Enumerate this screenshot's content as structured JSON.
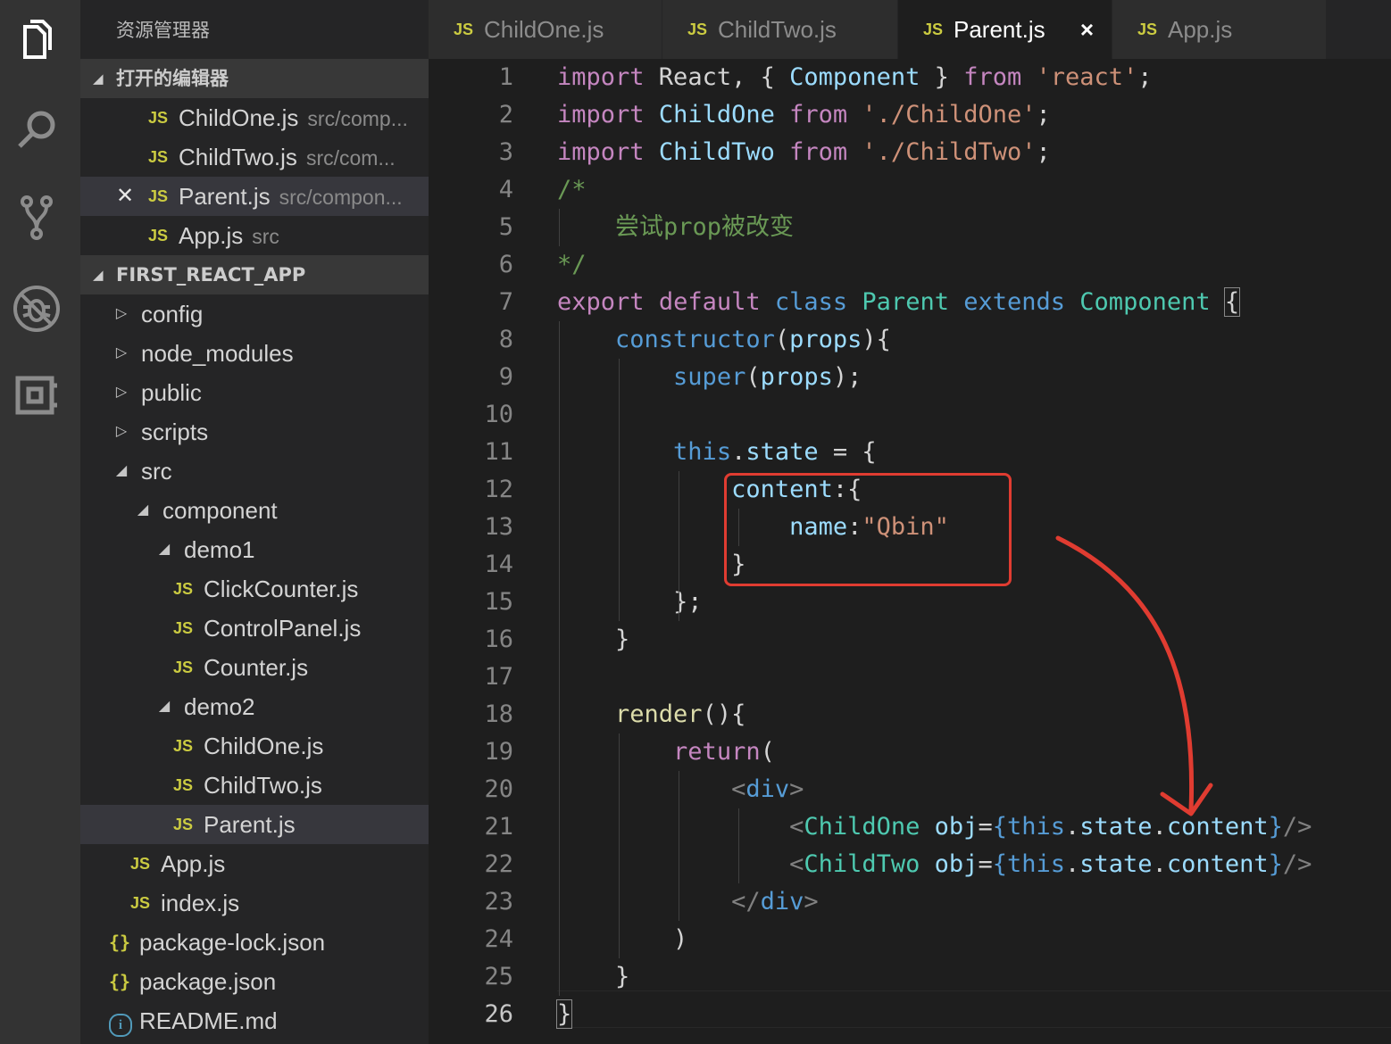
{
  "sidebar": {
    "title": "资源管理器",
    "open_editors": {
      "header": "打开的编辑器",
      "items": [
        {
          "name": "ChildOne.js",
          "path": "src/comp..."
        },
        {
          "name": "ChildTwo.js",
          "path": "src/com..."
        },
        {
          "name": "Parent.js",
          "path": "src/compon..."
        },
        {
          "name": "App.js",
          "path": "src"
        }
      ]
    },
    "project": {
      "header": "FIRST_REACT_APP",
      "tree": [
        {
          "label": "config",
          "kind": "folder-collapsed"
        },
        {
          "label": "node_modules",
          "kind": "folder-collapsed"
        },
        {
          "label": "public",
          "kind": "folder-collapsed"
        },
        {
          "label": "scripts",
          "kind": "folder-collapsed"
        },
        {
          "label": "src",
          "kind": "folder-expanded"
        },
        {
          "label": "component",
          "kind": "folder-expanded"
        },
        {
          "label": "demo1",
          "kind": "folder-expanded"
        },
        {
          "label": "ClickCounter.js",
          "kind": "js"
        },
        {
          "label": "ControlPanel.js",
          "kind": "js"
        },
        {
          "label": "Counter.js",
          "kind": "js"
        },
        {
          "label": "demo2",
          "kind": "folder-expanded"
        },
        {
          "label": "ChildOne.js",
          "kind": "js"
        },
        {
          "label": "ChildTwo.js",
          "kind": "js"
        },
        {
          "label": "Parent.js",
          "kind": "js"
        },
        {
          "label": "App.js",
          "kind": "js"
        },
        {
          "label": "index.js",
          "kind": "js"
        },
        {
          "label": "package-lock.json",
          "kind": "json"
        },
        {
          "label": "package.json",
          "kind": "json"
        },
        {
          "label": "README.md",
          "kind": "info"
        }
      ]
    }
  },
  "icons": {
    "js": "JS",
    "json": "{}",
    "info": "i",
    "close": "×",
    "close_dirty": "✕",
    "tri_down": "◢",
    "tri_right": "▷"
  },
  "tabs": [
    {
      "label": "ChildOne.js",
      "active": false
    },
    {
      "label": "ChildTwo.js",
      "active": false
    },
    {
      "label": "Parent.js",
      "active": true
    },
    {
      "label": "App.js",
      "active": false
    }
  ],
  "editor": {
    "current_line": 26,
    "line_numbers": [
      "1",
      "2",
      "3",
      "4",
      "5",
      "6",
      "7",
      "8",
      "9",
      "10",
      "11",
      "12",
      "13",
      "14",
      "15",
      "16",
      "17",
      "18",
      "19",
      "20",
      "21",
      "22",
      "23",
      "24",
      "25",
      "26"
    ],
    "lines": [
      [
        {
          "t": "import",
          "c": "kw"
        },
        {
          "t": " React, { ",
          "c": ""
        },
        {
          "t": "Component",
          "c": "vr"
        },
        {
          "t": " } ",
          "c": ""
        },
        {
          "t": "from",
          "c": "kw"
        },
        {
          "t": " ",
          "c": ""
        },
        {
          "t": "'react'",
          "c": "st"
        },
        {
          "t": ";",
          "c": ""
        }
      ],
      [
        {
          "t": "import",
          "c": "kw"
        },
        {
          "t": " ",
          "c": ""
        },
        {
          "t": "ChildOne",
          "c": "vr"
        },
        {
          "t": " ",
          "c": ""
        },
        {
          "t": "from",
          "c": "kw"
        },
        {
          "t": " ",
          "c": ""
        },
        {
          "t": "'./ChildOne'",
          "c": "st"
        },
        {
          "t": ";",
          "c": ""
        }
      ],
      [
        {
          "t": "import",
          "c": "kw"
        },
        {
          "t": " ",
          "c": ""
        },
        {
          "t": "ChildTwo",
          "c": "vr"
        },
        {
          "t": " ",
          "c": ""
        },
        {
          "t": "from",
          "c": "kw"
        },
        {
          "t": " ",
          "c": ""
        },
        {
          "t": "'./ChildTwo'",
          "c": "st"
        },
        {
          "t": ";",
          "c": ""
        }
      ],
      [
        {
          "t": "/*",
          "c": "cm"
        }
      ],
      [
        {
          "t": "    尝试prop被改变",
          "c": "cm"
        }
      ],
      [
        {
          "t": "*/",
          "c": "cm"
        }
      ],
      [
        {
          "t": "export",
          "c": "kw"
        },
        {
          "t": " ",
          "c": ""
        },
        {
          "t": "default",
          "c": "kw"
        },
        {
          "t": " ",
          "c": ""
        },
        {
          "t": "class",
          "c": "bl"
        },
        {
          "t": " ",
          "c": ""
        },
        {
          "t": "Parent",
          "c": "cls"
        },
        {
          "t": " ",
          "c": ""
        },
        {
          "t": "extends",
          "c": "bl"
        },
        {
          "t": " ",
          "c": ""
        },
        {
          "t": "Component",
          "c": "cls"
        },
        {
          "t": " ",
          "c": ""
        },
        {
          "t": "{",
          "c": "box"
        }
      ],
      [
        {
          "t": "    ",
          "c": ""
        },
        {
          "t": "constructor",
          "c": "bl"
        },
        {
          "t": "(",
          "c": ""
        },
        {
          "t": "props",
          "c": "vr"
        },
        {
          "t": "){",
          "c": ""
        }
      ],
      [
        {
          "t": "        ",
          "c": ""
        },
        {
          "t": "super",
          "c": "bl"
        },
        {
          "t": "(",
          "c": ""
        },
        {
          "t": "props",
          "c": "vr"
        },
        {
          "t": ");",
          "c": ""
        }
      ],
      [
        {
          "t": "",
          "c": ""
        }
      ],
      [
        {
          "t": "        ",
          "c": ""
        },
        {
          "t": "this",
          "c": "bl"
        },
        {
          "t": ".",
          "c": ""
        },
        {
          "t": "state",
          "c": "vr"
        },
        {
          "t": " = {",
          "c": ""
        }
      ],
      [
        {
          "t": "            ",
          "c": ""
        },
        {
          "t": "content",
          "c": "vr"
        },
        {
          "t": ":{",
          "c": ""
        }
      ],
      [
        {
          "t": "                ",
          "c": ""
        },
        {
          "t": "name",
          "c": "vr"
        },
        {
          "t": ":",
          "c": ""
        },
        {
          "t": "\"Qbin\"",
          "c": "st"
        }
      ],
      [
        {
          "t": "            }",
          "c": ""
        }
      ],
      [
        {
          "t": "        };",
          "c": ""
        }
      ],
      [
        {
          "t": "    }",
          "c": ""
        }
      ],
      [
        {
          "t": "",
          "c": ""
        }
      ],
      [
        {
          "t": "    ",
          "c": ""
        },
        {
          "t": "render",
          "c": "fn"
        },
        {
          "t": "(){",
          "c": ""
        }
      ],
      [
        {
          "t": "        ",
          "c": ""
        },
        {
          "t": "return",
          "c": "kw"
        },
        {
          "t": "(",
          "c": ""
        }
      ],
      [
        {
          "t": "            ",
          "c": ""
        },
        {
          "t": "<",
          "c": "tg"
        },
        {
          "t": "div",
          "c": "bl"
        },
        {
          "t": ">",
          "c": "tg"
        }
      ],
      [
        {
          "t": "                ",
          "c": ""
        },
        {
          "t": "<",
          "c": "tg"
        },
        {
          "t": "ChildOne",
          "c": "cls"
        },
        {
          "t": " ",
          "c": ""
        },
        {
          "t": "obj",
          "c": "vr"
        },
        {
          "t": "=",
          "c": ""
        },
        {
          "t": "{",
          "c": "bl"
        },
        {
          "t": "this",
          "c": "bl"
        },
        {
          "t": ".",
          "c": ""
        },
        {
          "t": "state",
          "c": "vr"
        },
        {
          "t": ".",
          "c": ""
        },
        {
          "t": "content",
          "c": "vr"
        },
        {
          "t": "}",
          "c": "bl"
        },
        {
          "t": "/>",
          "c": "tg"
        }
      ],
      [
        {
          "t": "                ",
          "c": ""
        },
        {
          "t": "<",
          "c": "tg"
        },
        {
          "t": "ChildTwo",
          "c": "cls"
        },
        {
          "t": " ",
          "c": ""
        },
        {
          "t": "obj",
          "c": "vr"
        },
        {
          "t": "=",
          "c": ""
        },
        {
          "t": "{",
          "c": "bl"
        },
        {
          "t": "this",
          "c": "bl"
        },
        {
          "t": ".",
          "c": ""
        },
        {
          "t": "state",
          "c": "vr"
        },
        {
          "t": ".",
          "c": ""
        },
        {
          "t": "content",
          "c": "vr"
        },
        {
          "t": "}",
          "c": "bl"
        },
        {
          "t": "/>",
          "c": "tg"
        }
      ],
      [
        {
          "t": "            ",
          "c": ""
        },
        {
          "t": "</",
          "c": "tg"
        },
        {
          "t": "div",
          "c": "bl"
        },
        {
          "t": ">",
          "c": "tg"
        }
      ],
      [
        {
          "t": "        )",
          "c": ""
        }
      ],
      [
        {
          "t": "    }",
          "c": ""
        }
      ],
      [
        {
          "t": "}",
          "c": "box"
        }
      ]
    ]
  },
  "annotations": {
    "box_color": "#e03c31",
    "arrow_color": "#e03c31"
  },
  "colors": {
    "activity_bar": "#333333",
    "sidebar": "#252526",
    "editor": "#1e1e1e",
    "js_icon": "#cbcb41"
  }
}
